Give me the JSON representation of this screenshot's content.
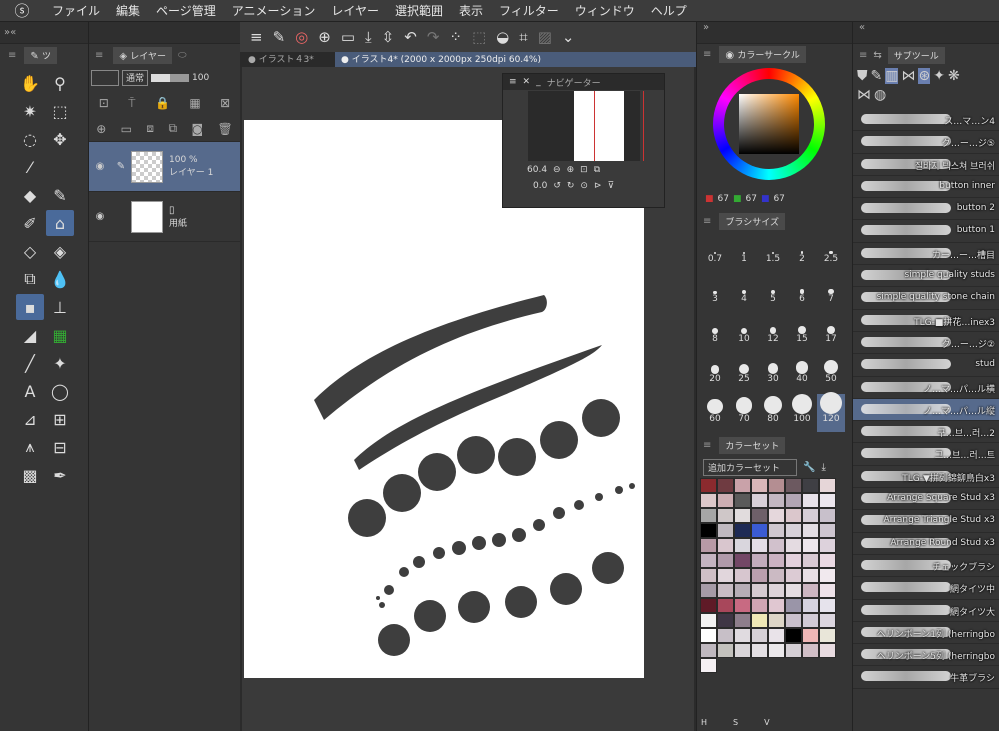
{
  "menu": [
    "ファイル",
    "編集",
    "ページ管理",
    "アニメーション",
    "レイヤー",
    "選択範囲",
    "表示",
    "フィルター",
    "ウィンドウ",
    "ヘルプ"
  ],
  "tools_tab": "ツ",
  "layer_panel": {
    "tab": "レイヤー",
    "blend_mode": "通常",
    "opacity": "100",
    "layers": [
      {
        "opacity": "100 %",
        "name": "レイヤー 1",
        "selected": true
      },
      {
        "name": "用紙",
        "selected": false
      }
    ]
  },
  "tabs": {
    "tab1": "イラスト４3*",
    "tab2": "イラスト4* (2000 x 2000px 250dpi 60.4%)"
  },
  "navigator": {
    "title": "ナビゲーター",
    "zoom": "60.4",
    "rotation": "0.0"
  },
  "color_circle": {
    "tab": "カラーサークル",
    "rgb": [
      "67",
      "67",
      "67"
    ]
  },
  "brush_size": {
    "tab": "ブラシサイズ",
    "sizes": [
      "0.7",
      "1",
      "1.5",
      "2",
      "2.5",
      "3",
      "4",
      "5",
      "6",
      "7",
      "8",
      "10",
      "12",
      "15",
      "17",
      "20",
      "25",
      "30",
      "40",
      "50",
      "60",
      "70",
      "80",
      "100",
      "120"
    ],
    "selected": "120"
  },
  "color_set": {
    "tab": "カラーセット",
    "dropdown": "追加カラーセット",
    "bottom_labels": [
      "H",
      "S",
      "V"
    ],
    "swatches": [
      "#8b2a2e",
      "#6f3b41",
      "#c9a2a9",
      "#d9b7b9",
      "#b48e92",
      "#6c5960",
      "#3f3f44",
      "#e6d6d8",
      "#dcc7c9",
      "#cdaeb3",
      "#5a5a5a",
      "#d8d0d8",
      "#c3b7c2",
      "#b2a5b4",
      "#e8e2ea",
      "#ece6ee",
      "#a6a6a6",
      "#cfc7c8",
      "#e1dcdd",
      "#6e6069",
      "#e5d7dc",
      "#dbc7cc",
      "#d5cdd6",
      "#c8c0cb",
      "#000000",
      "#c0b9c0",
      "#1e2a55",
      "#3a5bd3",
      "#cfc7cf",
      "#d7d1d9",
      "#e2dde3",
      "#cdc5cf",
      "#b89aa6",
      "#d9c6ce",
      "#d9d6dd",
      "#e3dde6",
      "#d1c1cc",
      "#e4dbe1",
      "#ede6ec",
      "#ddd2dc",
      "#c4b4c1",
      "#b09aaa",
      "#734766",
      "#c2acbc",
      "#cbb2c2",
      "#e3d0dc",
      "#d8c9d3",
      "#ead9e3",
      "#cfbfc6",
      "#e1d6dc",
      "#d7c6cf",
      "#bb9fae",
      "#cbbac3",
      "#dccbd4",
      "#e8dfe5",
      "#f1e9ee",
      "#a69ba7",
      "#c8bcc4",
      "#b7adb6",
      "#d5cad0",
      "#ddd3d9",
      "#e5dde2",
      "#cdb6c2",
      "#eee2e9",
      "#5f1a27",
      "#a8475b",
      "#c86a82",
      "#cfa5b3",
      "#e0c7d1",
      "#9a95a8",
      "#d6d3e0",
      "#e6e3ec",
      "#f2f2f2",
      "#3f3645",
      "#8e7e8c",
      "#efe8b6",
      "#ddd5c7",
      "#c9c0cc",
      "#d1cad6",
      "#dcd6df",
      "#ffffff",
      "#c7bfc7",
      "#e0dbe0",
      "#d6d0d6",
      "#e9e3e9",
      "#000000",
      "#efb7b7",
      "#e9e6d9",
      "#bfb8bf",
      "#c3c1bd",
      "#d9d5d9",
      "#e3dfe3",
      "#ebe8eb",
      "#d5cfd5",
      "#d1bfc7",
      "#e8dbe0",
      "#f5f0f3"
    ]
  },
  "subtool": {
    "tab": "サブツール",
    "brushes": [
      {
        "name": "ス…マ…ン4"
      },
      {
        "name": "グ…ー…ジ⑤"
      },
      {
        "name": "질바지 텍스쳐 브러쉬"
      },
      {
        "name": "button inner"
      },
      {
        "name": "button 2"
      },
      {
        "name": "button 1"
      },
      {
        "name": "カー…ー…槽目"
      },
      {
        "name": "simple quality studs"
      },
      {
        "name": "simple quality stone chain"
      },
      {
        "name": "TLG-■拼花…inex3"
      },
      {
        "name": "グ…ー…ジ②"
      },
      {
        "name": "stud"
      },
      {
        "name": "ノ…マ…パ…ル横"
      },
      {
        "name": "ノ…マ…パ…ル縦",
        "selected": true
      },
      {
        "name": "구…브…러…2"
      },
      {
        "name": "그…브…러…트"
      },
      {
        "name": "TLG-▼拼列錦鉚鳥白x3"
      },
      {
        "name": "Arrange Square Stud x3"
      },
      {
        "name": "Arrange Triangle Stud x3"
      },
      {
        "name": "Arrange Round Stud x3"
      },
      {
        "name": "チェックブラシ"
      },
      {
        "name": "網タイツ中"
      },
      {
        "name": "網タイツ大"
      },
      {
        "name": "ヘリンボーン1列 (herringbo"
      },
      {
        "name": "ヘリンボーン5列 (herringbo"
      },
      {
        "name": "牛革ブラシ"
      }
    ]
  }
}
